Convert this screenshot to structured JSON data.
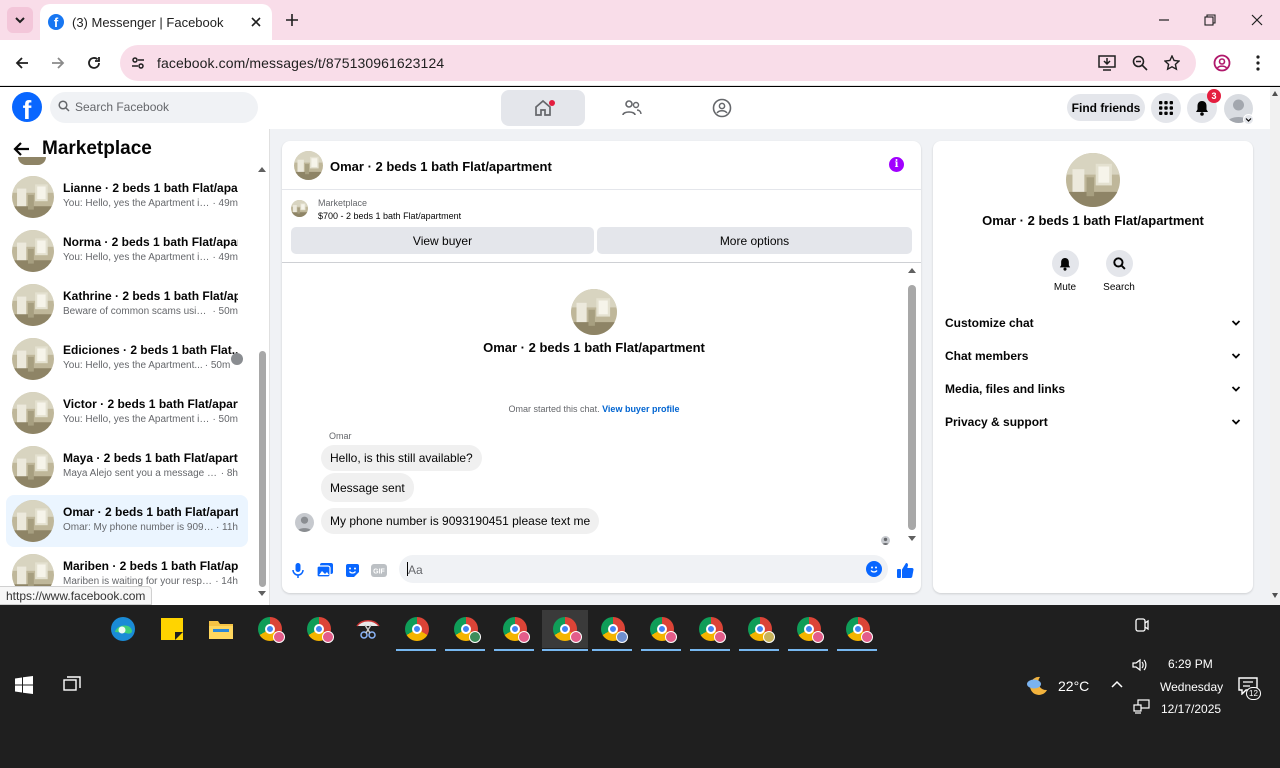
{
  "browser": {
    "tab_title": "(3) Messenger | Facebook",
    "url": "facebook.com/messages/t/875130961623124",
    "status_url": "https://www.facebook.com"
  },
  "fb": {
    "search_placeholder": "Search Facebook",
    "find_friends": "Find friends",
    "notif_count": "3"
  },
  "sidebar": {
    "title": "Marketplace",
    "conversations": [
      {
        "name": "Lianne · 2 beds 1 bath Flat/apar...",
        "preview": "You: Hello, yes the Apartment is ...",
        "time": "· 49m",
        "active": false
      },
      {
        "name": "Norma · 2 beds 1 bath Flat/apart...",
        "preview": "You: Hello, yes the Apartment is ...",
        "time": "· 49m",
        "active": false
      },
      {
        "name": "Kathrine · 2 beds 1 bath Flat/apar...",
        "preview": "Beware of common scams using...",
        "time": "· 50m",
        "active": false
      },
      {
        "name": "Ediciones · 2 beds 1 bath Flat...",
        "preview": "You: Hello, yes the Apartment...",
        "time": "· 50m",
        "active": false
      },
      {
        "name": "Victor · 2 beds 1 bath Flat/apart...",
        "preview": "You: Hello, yes the Apartment is ...",
        "time": "· 50m",
        "active": false
      },
      {
        "name": "Maya · 2 beds 1 bath Flat/apart...",
        "preview": "Maya Alejo sent you a message ab...",
        "time": "· 8h",
        "active": false
      },
      {
        "name": "Omar · 2 beds 1 bath Flat/apart...",
        "preview": "Omar: My phone number is 9093...",
        "time": "· 11h",
        "active": true
      },
      {
        "name": "Mariben · 2 beds 1 bath Flat/ap...",
        "preview": "Mariben is waiting for your respo...",
        "time": "· 14h",
        "active": false
      }
    ]
  },
  "chat": {
    "header_name": "Omar · 2 beds 1 bath Flat/apartment",
    "marketplace_label": "Marketplace",
    "listing": "$700 - 2 beds 1 bath Flat/apartment",
    "view_buyer": "View buyer",
    "more_options": "More options",
    "intro_name": "Omar · 2 beds 1 bath Flat/apartment",
    "started_text": "Omar started this chat.",
    "started_link": "View buyer profile",
    "sender": "Omar",
    "messages": [
      {
        "text": "Hello, is this still available?"
      },
      {
        "text": "Message sent"
      },
      {
        "text": "My phone number is 9093190451 please text me"
      }
    ],
    "composer_placeholder": "Aa"
  },
  "panel": {
    "name": "Omar · 2 beds 1 bath Flat/apartment",
    "mute": "Mute",
    "search": "Search",
    "rows": [
      "Customize chat",
      "Chat members",
      "Media, files and links",
      "Privacy & support"
    ]
  },
  "taskbar": {
    "temperature": "22°C",
    "time": "6:29 PM",
    "day": "Wednesday",
    "date": "12/17/2025",
    "notif_count": "12"
  },
  "colors": {
    "brand": "#0866ff",
    "accent_purple": "#a100ff",
    "tab_pink": "#f9dde9",
    "notif_red": "#e41e3f"
  }
}
